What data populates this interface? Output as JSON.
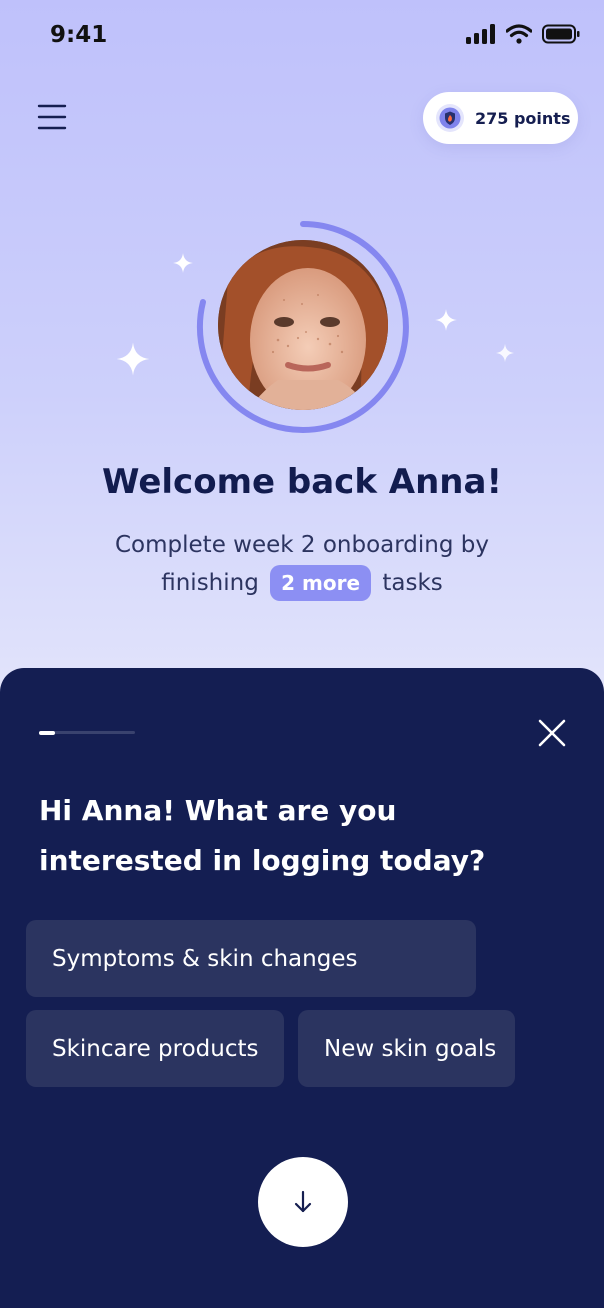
{
  "status_bar": {
    "time": "9:41"
  },
  "header": {
    "points_label": "275 points"
  },
  "hero": {
    "welcome": "Welcome back Anna!",
    "subtitle_line1": "Complete week 2 onboarding by",
    "subtitle_pre": "finishing",
    "badge": "2 more",
    "subtitle_post": "tasks"
  },
  "sheet": {
    "question_line1": "Hi Anna! What are you",
    "question_line2": "interested in logging today?",
    "options": [
      "Symptoms & skin changes",
      "Skincare products",
      "New skin goals"
    ]
  },
  "colors": {
    "accent": "#8c8ff3",
    "sheet_bg": "#141e52",
    "chip_bg": "#2b3460"
  },
  "icons": [
    "menu-icon",
    "points-shield-icon",
    "close-icon",
    "arrow-down-icon"
  ]
}
